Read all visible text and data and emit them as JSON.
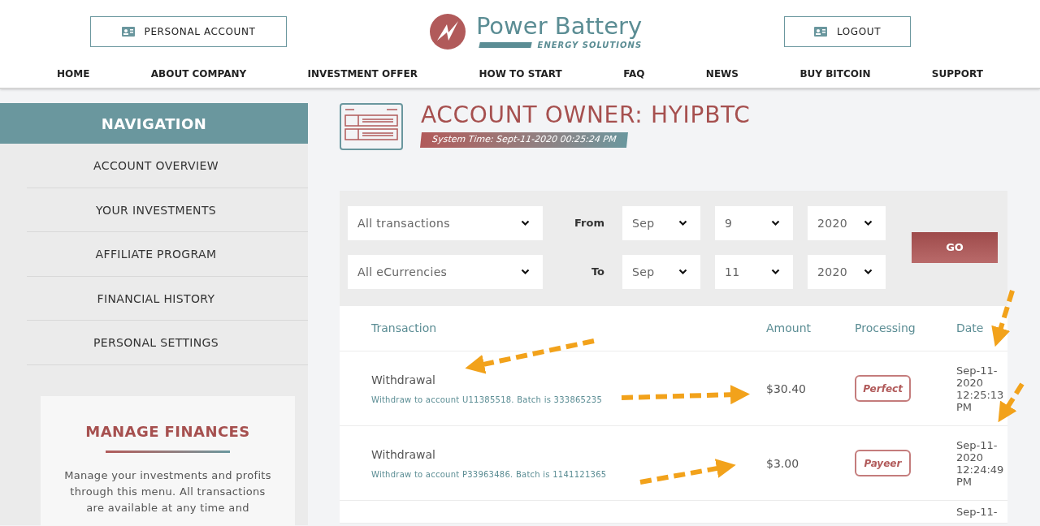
{
  "header": {
    "account_button": "PERSONAL ACCOUNT",
    "logo": {
      "name": "Power Battery",
      "tagline": "ENERGY SOLUTIONS"
    },
    "logout_button": "LOGOUT"
  },
  "menu": [
    "HOME",
    "ABOUT COMPANY",
    "INVESTMENT OFFER",
    "HOW TO START",
    "FAQ",
    "NEWS",
    "BUY BITCOIN",
    "SUPPORT"
  ],
  "sidebar": {
    "title": "NAVIGATION",
    "items": [
      "ACCOUNT OVERVIEW",
      "YOUR INVESTMENTS",
      "AFFILIATE PROGRAM",
      "FINANCIAL HISTORY",
      "PERSONAL SETTINGS"
    ],
    "card": {
      "title": "MANAGE FINANCES",
      "text": "Manage your investments and profits through this menu. All transactions are available at any time and"
    }
  },
  "page": {
    "title": "ACCOUNT OWNER: HYIPBTC",
    "system_time": "System Time: Sept-11-2020 00:25:24 PM"
  },
  "filters": {
    "type": "All transactions",
    "currency": "All eCurrencies",
    "from_label": "From",
    "to_label": "To",
    "from": [
      "Sep",
      "9",
      "2020"
    ],
    "to": [
      "Sep",
      "11",
      "2020"
    ],
    "go": "GO"
  },
  "table": {
    "columns": [
      "Transaction",
      "Amount",
      "Processing",
      "Date"
    ],
    "rows": [
      {
        "type": "Withdrawal",
        "detail": "Withdraw to account U11385518. Batch is 333865235",
        "amount": "$30.40",
        "processor": "Perfect",
        "date": [
          "Sep-11-",
          "2020",
          "12:25:13",
          "PM"
        ]
      },
      {
        "type": "Withdrawal",
        "detail": "Withdraw to account P33963486. Batch is 1141121365",
        "amount": "$3.00",
        "processor": "Payeer",
        "date": [
          "Sep-11-",
          "2020",
          "12:24:49",
          "PM"
        ]
      },
      {
        "date": [
          "Sep-11-"
        ]
      }
    ]
  }
}
